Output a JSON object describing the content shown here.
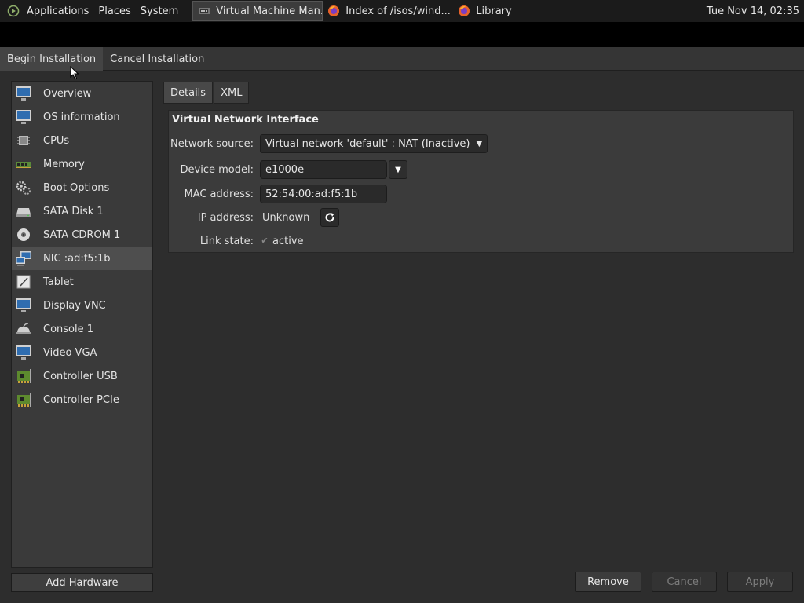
{
  "panel": {
    "menus": [
      "Applications",
      "Places",
      "System"
    ],
    "tasks": [
      {
        "label": "Virtual Machine Man...",
        "icon": "virt-manager-icon"
      },
      {
        "label": "Index of /isos/wind...",
        "icon": "firefox-icon"
      },
      {
        "label": "Library",
        "icon": "firefox-icon"
      }
    ],
    "clock": "Tue Nov 14, 02:35"
  },
  "toolbar": {
    "begin_label": "Begin Installation",
    "cancel_label": "Cancel Installation"
  },
  "sidebar": {
    "items": [
      {
        "label": "Overview",
        "icon": "monitor-icon"
      },
      {
        "label": "OS information",
        "icon": "monitor-icon"
      },
      {
        "label": "CPUs",
        "icon": "cpu-icon"
      },
      {
        "label": "Memory",
        "icon": "memory-icon"
      },
      {
        "label": "Boot Options",
        "icon": "gears-icon"
      },
      {
        "label": "SATA Disk 1",
        "icon": "disk-icon"
      },
      {
        "label": "SATA CDROM 1",
        "icon": "cdrom-icon"
      },
      {
        "label": "NIC :ad:f5:1b",
        "icon": "network-icon"
      },
      {
        "label": "Tablet",
        "icon": "tablet-icon"
      },
      {
        "label": "Display VNC",
        "icon": "monitor-icon"
      },
      {
        "label": "Console 1",
        "icon": "console-icon"
      },
      {
        "label": "Video VGA",
        "icon": "monitor-icon"
      },
      {
        "label": "Controller USB",
        "icon": "controller-icon"
      },
      {
        "label": "Controller PCIe",
        "icon": "controller-icon"
      }
    ],
    "selected": "NIC :ad:f5:1b",
    "add_label": "Add Hardware"
  },
  "tabs": {
    "details": "Details",
    "xml": "XML"
  },
  "nic": {
    "title": "Virtual Network Interface",
    "source_label": "Network source:",
    "source_value": "Virtual network 'default' : NAT (Inactive)",
    "model_label": "Device model:",
    "model_value": "e1000e",
    "mac_label": "MAC address:",
    "mac_value": "52:54:00:ad:f5:1b",
    "ip_label": "IP address:",
    "ip_value": "Unknown",
    "link_label": "Link state:",
    "link_value": "active",
    "link_checked": true
  },
  "buttons": {
    "remove": "Remove",
    "cancel": "Cancel",
    "apply": "Apply"
  },
  "colors": {
    "panel_bg": "#1b1b1b",
    "window_bg": "#2d2d2d",
    "selected_row": "#4e4e4e"
  }
}
